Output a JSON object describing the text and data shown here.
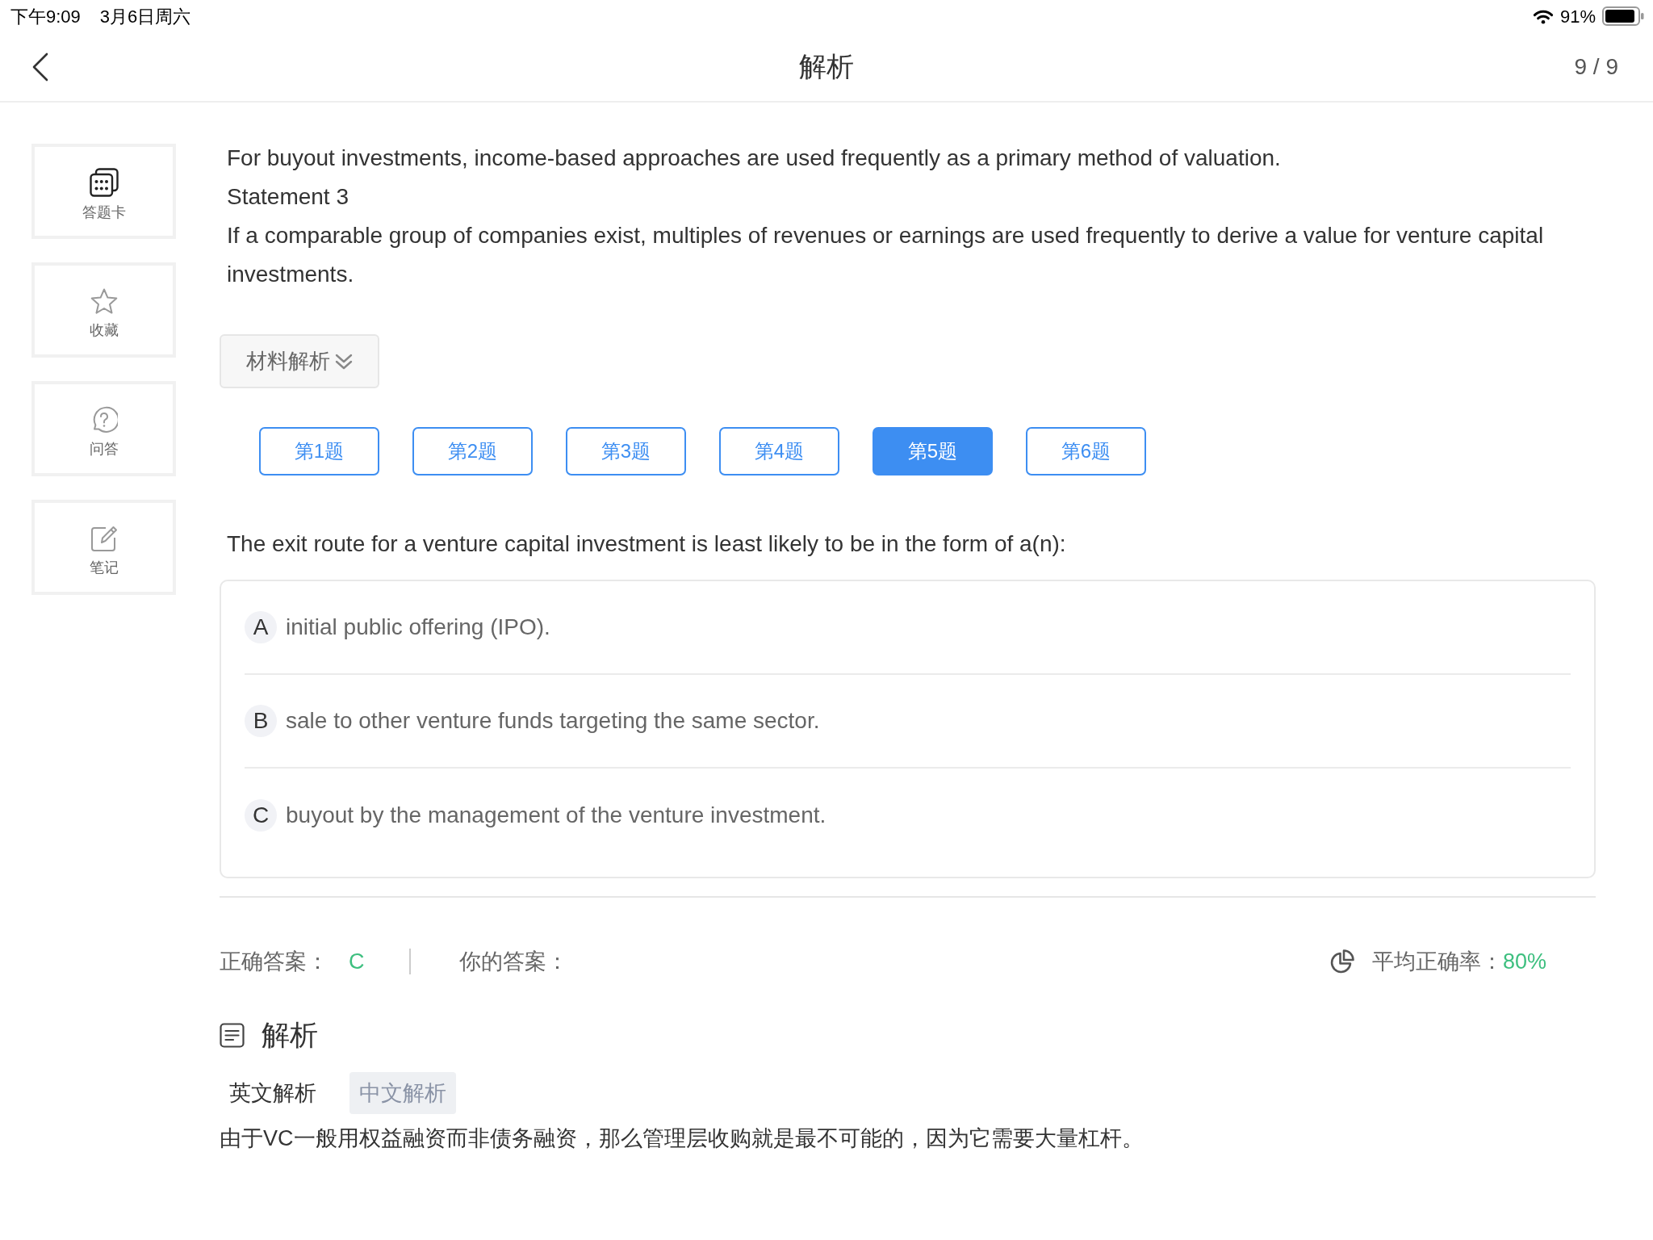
{
  "status_bar": {
    "time": "下午9:09",
    "date": "3月6日周六",
    "battery": "91%"
  },
  "nav_bar": {
    "title": "解析",
    "counter": "9 / 9"
  },
  "sidebar": {
    "items": [
      {
        "kind": "card",
        "label": "答题卡"
      },
      {
        "kind": "favorite",
        "label": "收藏"
      },
      {
        "kind": "ask",
        "label": "问答"
      },
      {
        "kind": "note",
        "label": "笔记"
      }
    ]
  },
  "material": {
    "paragraphs": [
      "For buyout investments, income-based approaches are used frequently as a primary method of valuation.",
      "Statement 3",
      "If a comparable group of companies exist, multiples of revenues or earnings are used frequently to derive a value for venture capital investments."
    ],
    "toggle": "材料解析"
  },
  "question_tabs": [
    {
      "label": "第1题",
      "selected": false
    },
    {
      "label": "第2题",
      "selected": false
    },
    {
      "label": "第3题",
      "selected": false
    },
    {
      "label": "第4题",
      "selected": false
    },
    {
      "label": "第5题",
      "selected": true
    },
    {
      "label": "第6题",
      "selected": false
    }
  ],
  "question": {
    "text": "The exit route for a venture capital investment is least likely to be in the form of a(n):",
    "options": [
      {
        "letter": "A",
        "text": "initial public offering (IPO).",
        "selected": false
      },
      {
        "letter": "B",
        "text": "sale to other venture funds targeting the same sector.",
        "selected": false
      },
      {
        "letter": "C",
        "text": "buyout by the management of the venture investment.",
        "selected": false
      }
    ]
  },
  "result": {
    "correct_label": "正确答案：",
    "correct_answer": "C",
    "your_label": "你的答案：",
    "average_label": "平均正确率：",
    "average_rate": "80%"
  },
  "analysis": {
    "title": "解析",
    "tabs": [
      {
        "label": "英文解析",
        "selected": false
      },
      {
        "label": "中文解析",
        "selected": true
      }
    ],
    "text": "由于VC一般用权益融资而非债务融资，那么管理层收购就是最不可能的，因为它需要大量杠杆。"
  }
}
